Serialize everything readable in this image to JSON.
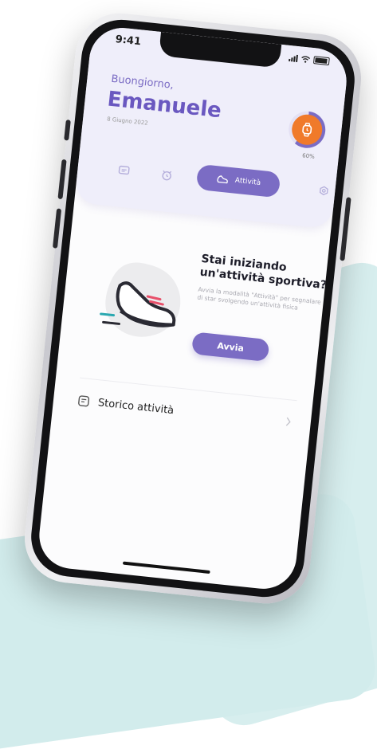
{
  "status": {
    "time": "9:41"
  },
  "header": {
    "greeting": "Buongiorno,",
    "name": "Emanuele",
    "date": "8 Giugno 2022",
    "progress": "60%",
    "progress_fraction": 0.6
  },
  "nav": {
    "active_label": "Attività",
    "items": [
      "chat-icon",
      "alarm-icon",
      "activity-icon",
      "settings-icon"
    ]
  },
  "promo": {
    "title": "Stai iniziando un'attività sportiva?",
    "description": "Avvia la modalità \"Attività\" per segnalare di star svolgendo un'attività fisica",
    "button_label": "Avvia"
  },
  "history": {
    "label": "Storico attività"
  },
  "colors": {
    "accent": "#7b6cc4",
    "orange": "#f07a2a",
    "background_teal": "#d7eeee"
  }
}
